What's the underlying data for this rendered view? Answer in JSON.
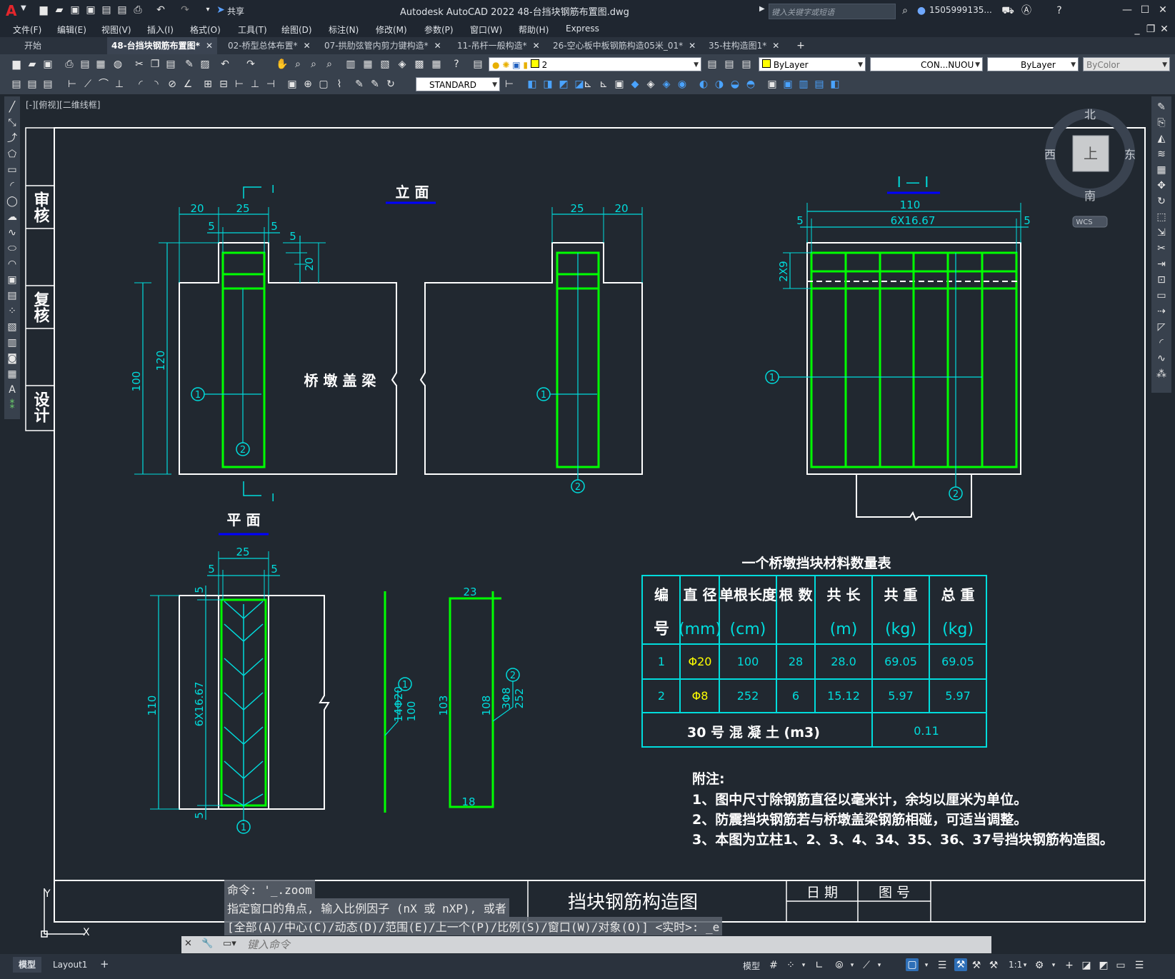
{
  "app": {
    "title": "Autodesk AutoCAD 2022    48-台挡块钢筋布置图.dwg",
    "share": "共享",
    "search_placeholder": "键入关键字或短语",
    "user": "1505999135...",
    "logo": "A"
  },
  "menu": [
    "文件(F)",
    "编辑(E)",
    "视图(V)",
    "插入(I)",
    "格式(O)",
    "工具(T)",
    "绘图(D)",
    "标注(N)",
    "修改(M)",
    "参数(P)",
    "窗口(W)",
    "帮助(H)",
    "Express"
  ],
  "tabs": [
    {
      "label": "开始",
      "close": ""
    },
    {
      "label": "48-台挡块钢筋布置图*",
      "close": "✕"
    },
    {
      "label": "02-桥型总体布置*",
      "close": "✕"
    },
    {
      "label": "07-拱肋弦管内剪力键构造*",
      "close": "✕"
    },
    {
      "label": "11-吊杆一般构造*",
      "close": "✕"
    },
    {
      "label": "26-空心板中板钢筋构造05米_01*",
      "close": "✕"
    },
    {
      "label": "35-柱构造图1*",
      "close": "✕"
    }
  ],
  "toolbar": {
    "layer": "2",
    "color": "ByLayer",
    "linetype": "CON...NUOU",
    "lineweight": "ByLayer",
    "plotstyle": "ByColor",
    "textstyle": "STANDARD"
  },
  "viewport": {
    "label": "[-][俯视][二维线框]"
  },
  "viewcube": {
    "north": "北",
    "south": "南",
    "east": "东",
    "west": "西",
    "top": "上",
    "wcs": "WCS"
  },
  "side_labels": [
    "审核",
    "复核",
    "设计"
  ],
  "drawing": {
    "elevation_title": "立    面",
    "plan_title": "平    面",
    "section_title": "I — I",
    "beam_label": "桥 墩 盖 梁",
    "section_mark": "I",
    "dims": {
      "d20": "20",
      "d25": "25",
      "d5": "5",
      "d100": "100",
      "d120": "120",
      "d110": "110",
      "d6x1667": "6X16.67",
      "d2x9": "2X9",
      "d103": "103",
      "d108": "108",
      "d23": "23",
      "d18": "18",
      "d14phi20": "14Φ20",
      "d3phi8": "3Φ8",
      "d252": "252"
    },
    "markers": {
      "m1": "1",
      "m2": "2"
    }
  },
  "table": {
    "title": "一个桥墩挡块材料数量表",
    "headers": [
      {
        "top": "编",
        "bottom": "号"
      },
      {
        "top": "直 径",
        "bottom": "(mm)"
      },
      {
        "top": "单根长度",
        "bottom": "(cm)"
      },
      {
        "top": "根 数",
        "bottom": ""
      },
      {
        "top": "共 长",
        "bottom": "(m)"
      },
      {
        "top": "共 重",
        "bottom": "(kg)"
      },
      {
        "top": "总 重",
        "bottom": "(kg)"
      }
    ],
    "rows": [
      [
        "1",
        "Φ20",
        "100",
        "28",
        "28.0",
        "69.05",
        "69.05"
      ],
      [
        "2",
        "Φ8",
        "252",
        "6",
        "15.12",
        "5.97",
        "5.97"
      ]
    ],
    "concrete_label": "30 号 混 凝 土 (m3)",
    "concrete_value": "0.11"
  },
  "notes": {
    "title": "附注:",
    "lines": [
      "1、图中尺寸除钢筋直径以毫米计，余均以厘米为单位。",
      "2、防震挡块钢筋若与桥墩盖梁钢筋相碰，可适当调整。",
      "3、本图为立柱1、2、3、4、34、35、36、37号挡块钢筋构造图。"
    ]
  },
  "titleblock": {
    "name": "挡块钢筋构造图",
    "date": "日 期",
    "drawing_no": "图 号"
  },
  "command": {
    "history": [
      "命令:  '_.zoom",
      "指定窗口的角点, 输入比例因子 (nX 或 nXP), 或者",
      "[全部(A)/中心(C)/动态(D)/范围(E)/上一个(P)/比例(S)/窗口(W)/对象(O)] <实时>: _e"
    ],
    "placeholder": "键入命令"
  },
  "status": {
    "model_tab": "模型",
    "layout_tab": "Layout1",
    "plus": "+",
    "model_btn": "模型",
    "scale": "1:1"
  },
  "ucs": {
    "x": "X",
    "y": "Y"
  },
  "colors": {
    "green": "#00ff00",
    "cyan": "#00dcdc",
    "white": "#ffffff",
    "yellow": "#ffff00",
    "blue": "#0000ff",
    "bg": "#212830"
  }
}
